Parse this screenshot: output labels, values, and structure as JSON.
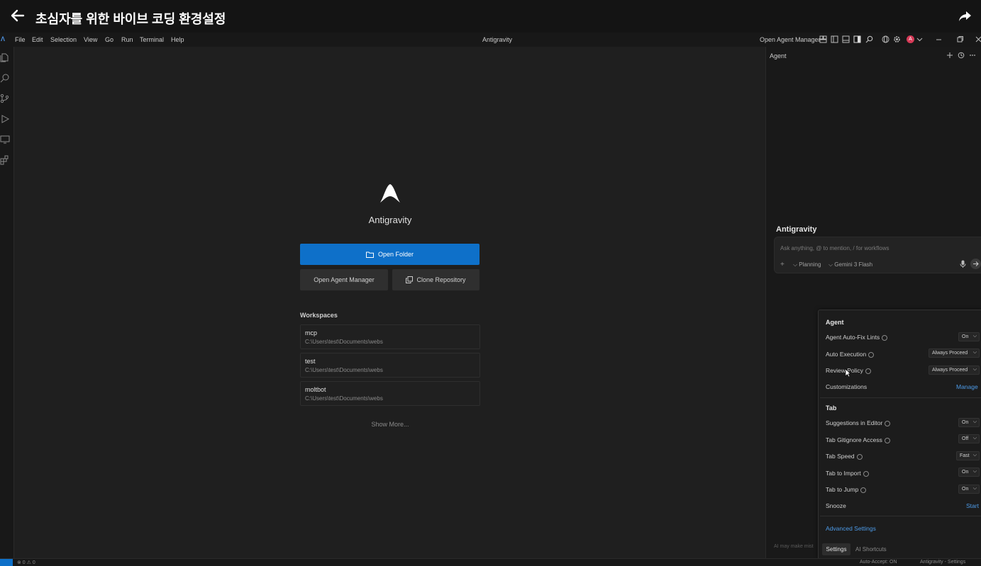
{
  "video": {
    "title": "초심자를 위한 바이브 코딩 환경설정"
  },
  "menubar": {
    "items": [
      "File",
      "Edit",
      "Selection",
      "View",
      "Go",
      "Run",
      "Terminal",
      "Help"
    ],
    "window_title": "Antigravity",
    "open_agent_manager": "Open Agent Manager",
    "avatar_initial": "A"
  },
  "welcome": {
    "title": "Antigravity",
    "open_folder": "Open Folder",
    "open_agent_manager": "Open Agent Manager",
    "clone_repository": "Clone Repository",
    "workspaces_heading": "Workspaces",
    "workspaces": [
      {
        "name": "mcp",
        "path": "C:\\Users\\test\\Documents\\webs"
      },
      {
        "name": "test",
        "path": "C:\\Users\\test\\Documents\\webs"
      },
      {
        "name": "moltbot",
        "path": "C:\\Users\\test\\Documents\\webs"
      }
    ],
    "show_more": "Show More..."
  },
  "agent_panel": {
    "title": "Agent",
    "section_title": "Antigravity",
    "chat_placeholder": "Ask anything, @ to mention, / for workflows",
    "planning": "Planning",
    "model": "Gemini 3 Flash",
    "disclaimer": "AI may make mist"
  },
  "settings": {
    "agent_heading": "Agent",
    "auto_fix_lints": {
      "label": "Agent Auto-Fix Lints",
      "value": "On"
    },
    "auto_execution": {
      "label": "Auto Execution",
      "value": "Always Proceed"
    },
    "review_policy": {
      "label": "Review Policy",
      "value": "Always Proceed"
    },
    "customizations": {
      "label": "Customizations",
      "action": "Manage"
    },
    "tab_heading": "Tab",
    "suggestions_in_editor": {
      "label": "Suggestions in Editor",
      "value": "On"
    },
    "tab_gitignore_access": {
      "label": "Tab Gitignore Access",
      "value": "Off"
    },
    "tab_speed": {
      "label": "Tab Speed",
      "value": "Fast"
    },
    "tab_to_import": {
      "label": "Tab to Import",
      "value": "On"
    },
    "tab_to_jump": {
      "label": "Tab to Jump",
      "value": "On"
    },
    "snooze": {
      "label": "Snooze",
      "action": "Start"
    },
    "advanced_settings": "Advanced Settings",
    "tabs": [
      "Settings",
      "AI Shortcuts"
    ]
  },
  "statusbar": {
    "problems": "⊗ 0 ⚠ 0",
    "auto_accept": "Auto-Accept: ON",
    "right": "Antigravity - Settings"
  },
  "colors": {
    "accent": "#0e70c9",
    "link": "#4d9be8",
    "avatar": "#d63a57"
  }
}
